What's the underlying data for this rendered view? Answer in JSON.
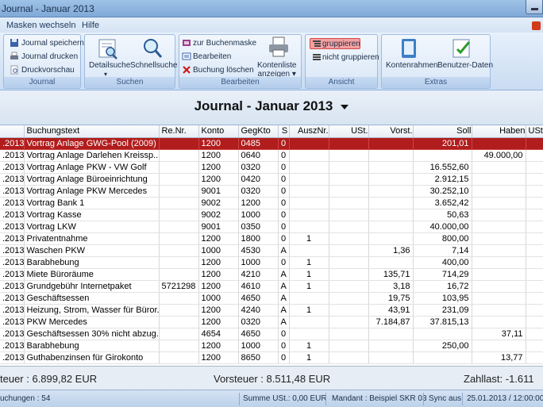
{
  "window": {
    "title": "Journal - Januar 2013"
  },
  "menu": {
    "items": [
      "Masken wechseln",
      "Hilfe"
    ]
  },
  "ribbon": {
    "journal": {
      "label": "Journal",
      "save": "Journal speichern",
      "print": "Journal drucken",
      "preview": "Druckvorschau"
    },
    "suchen": {
      "label": "Suchen",
      "detail": "Detailsuche",
      "schnell": "Schnellsuche"
    },
    "bearbeiten": {
      "label": "Bearbeiten",
      "buchungsmaske": "zur Buchenmaske",
      "edit": "Bearbeiten",
      "delete": "Buchung löschen",
      "kontenliste1": "Kontenliste",
      "kontenliste2": "anzeigen"
    },
    "ansicht": {
      "label": "Ansicht",
      "gruppieren": "gruppieren",
      "nicht": "nicht gruppieren"
    },
    "extras": {
      "label": "Extras",
      "kontenrahmen": "Kontenrahmen",
      "benutzer": "Benutzer-Daten"
    }
  },
  "journal_title": "Journal - Januar 2013",
  "table": {
    "headers": [
      "",
      "Buchungstext",
      "Re.Nr.",
      "Konto",
      "GegKto",
      "S",
      "AuszNr.",
      "USt.",
      "Vorst.",
      "Soll",
      "Haben",
      "USt"
    ],
    "rows": [
      [
        ".2013",
        "Vortrag Anlage GWG-Pool (2009)",
        "",
        "1200",
        "0485",
        "0",
        "",
        "",
        "",
        "201,01",
        ""
      ],
      [
        ".2013",
        "Vortrag Anlage Darlehen Kreissp...",
        "",
        "1200",
        "0640",
        "0",
        "",
        "",
        "",
        "",
        "49.000,00"
      ],
      [
        ".2013",
        "Vortrag Anlage PKW - VW Golf",
        "",
        "1200",
        "0320",
        "0",
        "",
        "",
        "",
        "16.552,60",
        ""
      ],
      [
        ".2013",
        "Vortrag Anlage Büroeinrichtung",
        "",
        "1200",
        "0420",
        "0",
        "",
        "",
        "",
        "2.912,15",
        ""
      ],
      [
        ".2013",
        "Vortrag Anlage PKW Mercedes",
        "",
        "9001",
        "0320",
        "0",
        "",
        "",
        "",
        "30.252,10",
        ""
      ],
      [
        ".2013",
        "Vortrag Bank 1",
        "",
        "9002",
        "1200",
        "0",
        "",
        "",
        "",
        "3.652,42",
        ""
      ],
      [
        ".2013",
        "Vortrag Kasse",
        "",
        "9002",
        "1000",
        "0",
        "",
        "",
        "",
        "50,63",
        ""
      ],
      [
        ".2013",
        "Vortrag LKW",
        "",
        "9001",
        "0350",
        "0",
        "",
        "",
        "",
        "40.000,00",
        ""
      ],
      [
        ".2013",
        "Privatentnahme",
        "",
        "1200",
        "1800",
        "0",
        "1",
        "",
        "",
        "800,00",
        ""
      ],
      [
        ".2013",
        "Waschen PKW",
        "",
        "1000",
        "4530",
        "A",
        "",
        "",
        "1,36",
        "7,14",
        ""
      ],
      [
        ".2013",
        "Barabhebung",
        "",
        "1200",
        "1000",
        "0",
        "1",
        "",
        "",
        "400,00",
        ""
      ],
      [
        ".2013",
        "Miete Büroräume",
        "",
        "1200",
        "4210",
        "A",
        "1",
        "",
        "135,71",
        "714,29",
        ""
      ],
      [
        ".2013",
        "Grundgebühr Internetpaket",
        "5721298",
        "1200",
        "4610",
        "A",
        "1",
        "",
        "3,18",
        "16,72",
        ""
      ],
      [
        ".2013",
        "Geschäftsessen",
        "",
        "1000",
        "4650",
        "A",
        "",
        "",
        "19,75",
        "103,95",
        ""
      ],
      [
        ".2013",
        "Heizung, Strom, Wasser für Büror...",
        "",
        "1200",
        "4240",
        "A",
        "1",
        "",
        "43,91",
        "231,09",
        ""
      ],
      [
        ".2013",
        "PKW Mercedes",
        "",
        "1200",
        "0320",
        "A",
        "",
        "",
        "7.184,87",
        "37.815,13",
        ""
      ],
      [
        ".2013",
        "Geschäftsessen 30% nicht abzug...",
        "",
        "4654",
        "4650",
        "0",
        "",
        "",
        "",
        "",
        "37,11"
      ],
      [
        ".2013",
        "Barabhebung",
        "",
        "1200",
        "1000",
        "0",
        "1",
        "",
        "",
        "250,00",
        ""
      ],
      [
        ".2013",
        "Guthabenzinsen für Girokonto",
        "",
        "1200",
        "8650",
        "0",
        "1",
        "",
        "",
        "",
        "13,77"
      ]
    ]
  },
  "summary": {
    "umsatzsteuer": "teuer :  6.899,82 EUR",
    "vorsteuer": "Vorsteuer :  8.511,48 EUR",
    "zahllast": "Zahllast:  -1.611"
  },
  "status": {
    "buchungen": "uchungen : 54",
    "summe": "Summe USt.: 0,00 EUR",
    "mandant": "Mandant : Beispiel SKR 03",
    "sync": "Sync aus",
    "datum": "25.01.2013 / 12:00:00"
  }
}
